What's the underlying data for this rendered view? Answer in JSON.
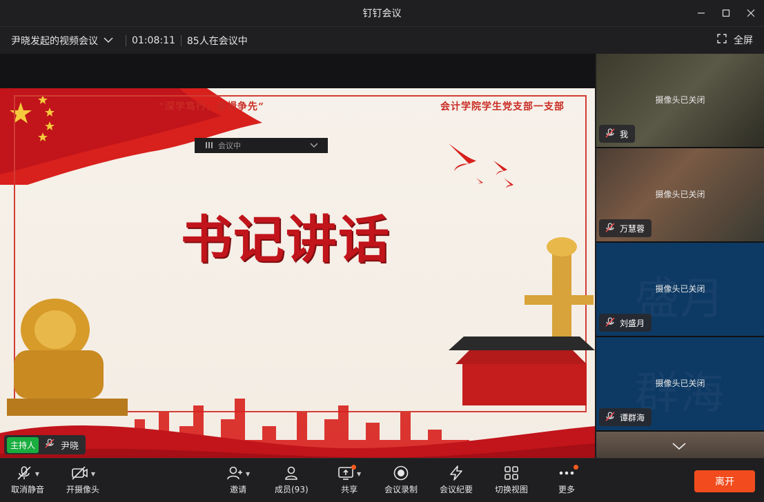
{
  "window": {
    "title": "钉钉会议",
    "minimize_icon": "minimize-icon",
    "maximize_icon": "maximize-icon",
    "close_icon": "close-icon"
  },
  "meeting": {
    "name": "尹晓发起的视频会议",
    "duration": "01:08:11",
    "participants_text": "85人在会议中",
    "fullscreen_label": "全屏"
  },
  "slide": {
    "slogan": "“深学笃行，奋楫争先“",
    "org": "会计学院学生党支部一支部",
    "headline": "书记讲话",
    "overlay_text": "会议中"
  },
  "presenter": {
    "badge": "主持人",
    "name": "尹晓"
  },
  "participants": [
    {
      "name": "我",
      "status": "摄像头已关闭"
    },
    {
      "name": "万慧蓉",
      "status": "摄像头已关闭"
    },
    {
      "name": "刘盛月",
      "status": "摄像头已关闭",
      "avatar_text": "盛月"
    },
    {
      "name": "谭群海",
      "status": "摄像头已关闭",
      "avatar_text": "群海"
    }
  ],
  "toolbar": {
    "unmute": "取消静音",
    "camera": "开摄像头",
    "invite": "邀请",
    "members": "成员(93)",
    "share": "共享",
    "record": "会议录制",
    "minutes": "会议纪要",
    "switch_view": "切换视图",
    "more": "更多",
    "leave": "离开"
  },
  "colors": {
    "accent": "#f24c1e",
    "host_badge": "#1aad3f",
    "avatar_bg": "#0d3a64"
  }
}
